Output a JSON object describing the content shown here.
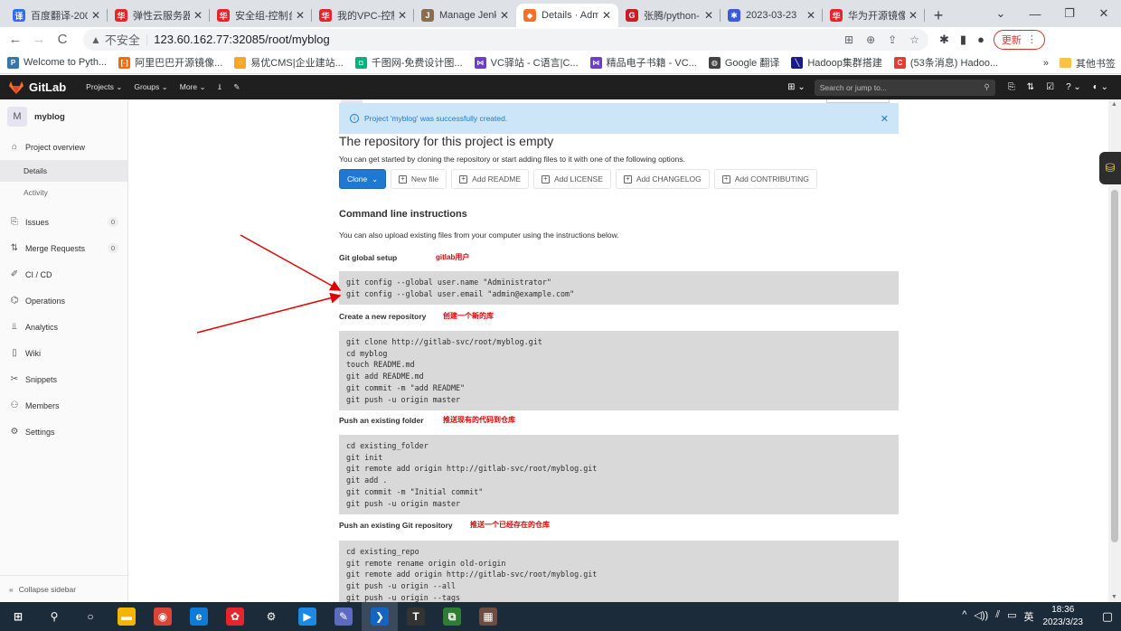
{
  "browser": {
    "tabs": [
      {
        "title": "百度翻译-200",
        "fav_color": "#2f6ef7",
        "fav_glyph": "译"
      },
      {
        "title": "弹性云服务器",
        "fav_color": "#e5242b",
        "fav_glyph": "华"
      },
      {
        "title": "安全组-控制台",
        "fav_color": "#e5242b",
        "fav_glyph": "华"
      },
      {
        "title": "我的VPC-控制",
        "fav_color": "#e5242b",
        "fav_glyph": "华"
      },
      {
        "title": "Manage Jenki",
        "fav_color": "#8a6d4b",
        "fav_glyph": "J"
      },
      {
        "title": "Details · Adm",
        "fav_color": "#fc6d26",
        "fav_glyph": "◆",
        "active": true
      },
      {
        "title": "张腾/python-",
        "fav_color": "#c71d23",
        "fav_glyph": "G"
      },
      {
        "title": "2023-03-23",
        "fav_color": "#3b5bdb",
        "fav_glyph": "✱"
      },
      {
        "title": "华为开源镜像",
        "fav_color": "#e5242b",
        "fav_glyph": "华"
      }
    ],
    "tab_close": "✕",
    "new_tab": "+",
    "window_controls": [
      "⌄",
      "—",
      "❐",
      "✕"
    ],
    "nav": {
      "back": "←",
      "forward": "→",
      "reload": "C"
    },
    "address": {
      "warning": "▲",
      "insecure": "不安全",
      "separator": "|",
      "url": "123.60.162.77:32085/root/myblog"
    },
    "omni_icons": [
      "⊞",
      "⊕",
      "⇪",
      "☆"
    ],
    "ext_icons": [
      "✱",
      "▮",
      "●"
    ],
    "update_label": "更新",
    "update_menu": "⋮",
    "bookmarks": [
      {
        "label": "Welcome to Pyth...",
        "color": "#3776ab",
        "glyph": "P"
      },
      {
        "label": "阿里巴巴开源镜像...",
        "color": "#ff6a00",
        "glyph": "[-]"
      },
      {
        "label": "易优CMS|企业建站...",
        "color": "#f5a623",
        "glyph": "◌"
      },
      {
        "label": "千图网-免费设计图...",
        "color": "#00b37e",
        "glyph": "◘"
      },
      {
        "label": "VC驿站 - C语言|C...",
        "color": "#6c3fc7",
        "glyph": "⋈"
      },
      {
        "label": "精品电子书籍 - VC...",
        "color": "#6c3fc7",
        "glyph": "⋈"
      },
      {
        "label": "Google 翻译",
        "color": "#444444",
        "glyph": "◍"
      },
      {
        "label": "Hadoop集群搭建",
        "color": "#1a1a8c",
        "glyph": "╲"
      },
      {
        "label": "(53条消息) Hadoo...",
        "color": "#e33e33",
        "glyph": "C"
      }
    ],
    "bookmarks_more": "»",
    "other_bookmarks": "其他书签"
  },
  "gitlab": {
    "brand": "GitLab",
    "nav": [
      "Projects ⌄",
      "Groups ⌄",
      "More ⌄",
      "⫫",
      "✎"
    ],
    "plus": "⊞ ⌄",
    "search_placeholder": "Search or jump to...",
    "search_icon": "⚲",
    "header_icons": [
      "⎘",
      "⇅",
      "☑",
      "? ⌄",
      "◐ ⌄"
    ]
  },
  "sidebar": {
    "project_initial": "M",
    "project_name": "myblog",
    "overview": {
      "icon": "⌂",
      "label": "Project overview"
    },
    "sub": [
      "Details",
      "Activity"
    ],
    "items": [
      {
        "icon": "⎘",
        "label": "Issues",
        "count": "0"
      },
      {
        "icon": "⇅",
        "label": "Merge Requests",
        "count": "0"
      },
      {
        "icon": "✐",
        "label": "CI / CD"
      },
      {
        "icon": "⌬",
        "label": "Operations"
      },
      {
        "icon": "⫫",
        "label": "Analytics"
      },
      {
        "icon": "▯",
        "label": "Wiki"
      },
      {
        "icon": "✂",
        "label": "Snippets"
      },
      {
        "icon": "⚇",
        "label": "Members"
      },
      {
        "icon": "⚙",
        "label": "Settings"
      }
    ],
    "collapse": {
      "icon": "«",
      "label": "Collapse sidebar"
    }
  },
  "main": {
    "alert": {
      "icon": "i",
      "text": "Project 'myblog' was successfully created.",
      "close": "✕"
    },
    "empty_title": "The repository for this project is empty",
    "empty_sub": "You can get started by cloning the repository or start adding files to it with one of the following options.",
    "clone_label": "Clone",
    "clone_caret": "⌄",
    "buttons": [
      "New file",
      "Add README",
      "Add LICENSE",
      "Add CHANGELOG",
      "Add CONTRIBUTING"
    ],
    "cmd_title": "Command line instructions",
    "cmd_sub": "You can also upload existing files from your computer using the instructions below.",
    "sections": [
      {
        "title": "Git global setup",
        "annotation": "gitlab用户",
        "code": "git config --global user.name \"Administrator\"\ngit config --global user.email \"admin@example.com\""
      },
      {
        "title": "Create a new repository",
        "annotation": "创建一个新的库",
        "code": "git clone http://gitlab-svc/root/myblog.git\ncd myblog\ntouch README.md\ngit add README.md\ngit commit -m \"add README\"\ngit push -u origin master"
      },
      {
        "title": "Push an existing folder",
        "annotation": "推送现有的代码到仓库",
        "code": "cd existing_folder\ngit init\ngit remote add origin http://gitlab-svc/root/myblog.git\ngit add .\ngit commit -m \"Initial commit\"\ngit push -u origin master"
      },
      {
        "title": "Push an existing Git repository",
        "annotation": "推送一个已经存在的仓库",
        "code": "cd existing_repo\ngit remote rename origin old-origin\ngit remote add origin http://gitlab-svc/root/myblog.git\ngit push -u origin --all\ngit push -u origin --tags"
      }
    ],
    "arrow_color": "#e00000"
  },
  "side_widget_icon": "⛁",
  "taskbar": {
    "icons": [
      {
        "name": "windows-start-icon",
        "glyph": "⊞",
        "color": "transparent"
      },
      {
        "name": "search-icon",
        "glyph": "⚲",
        "color": "transparent"
      },
      {
        "name": "task-view-icon",
        "glyph": "○",
        "color": "transparent"
      },
      {
        "name": "file-explorer-icon",
        "glyph": "▬",
        "color": "#f4b400"
      },
      {
        "name": "chrome-icon",
        "glyph": "◉",
        "color": "#db4437"
      },
      {
        "name": "edge-icon",
        "glyph": "e",
        "color": "#0f7bd7"
      },
      {
        "name": "huawei-icon",
        "glyph": "✿",
        "color": "#e5242b"
      },
      {
        "name": "settings-icon",
        "glyph": "⚙",
        "color": "transparent"
      },
      {
        "name": "app-icon",
        "glyph": "▶",
        "color": "#1e88e5"
      },
      {
        "name": "notes-icon",
        "glyph": "✎",
        "color": "#5c6bc0"
      },
      {
        "name": "editor-icon",
        "glyph": "❯",
        "color": "#1565c0"
      },
      {
        "name": "typora-icon",
        "glyph": "T",
        "color": "#333333"
      },
      {
        "name": "remote-icon",
        "glyph": "⧉",
        "color": "#2e7d32"
      },
      {
        "name": "image-app-icon",
        "glyph": "▦",
        "color": "#6d4c41"
      }
    ],
    "tray": [
      "^",
      "◁))",
      "⫽",
      "▭",
      "英"
    ],
    "time": "18:36",
    "date": "2023/3/23",
    "notification": "▢"
  }
}
